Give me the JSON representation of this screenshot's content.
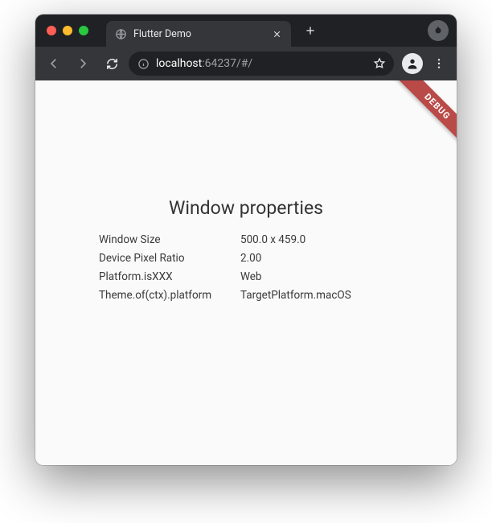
{
  "browser": {
    "tab_title": "Flutter Demo",
    "new_tab_label": "+",
    "url_host": "localhost",
    "url_rest": ":64237/#/"
  },
  "app": {
    "debug_banner": "DEBUG",
    "title": "Window properties",
    "rows": [
      {
        "label": "Window Size",
        "value": "500.0 x 459.0"
      },
      {
        "label": "Device Pixel Ratio",
        "value": "2.00"
      },
      {
        "label": "Platform.isXXX",
        "value": "Web"
      },
      {
        "label": "Theme.of(ctx).platform",
        "value": "TargetPlatform.macOS"
      }
    ]
  }
}
